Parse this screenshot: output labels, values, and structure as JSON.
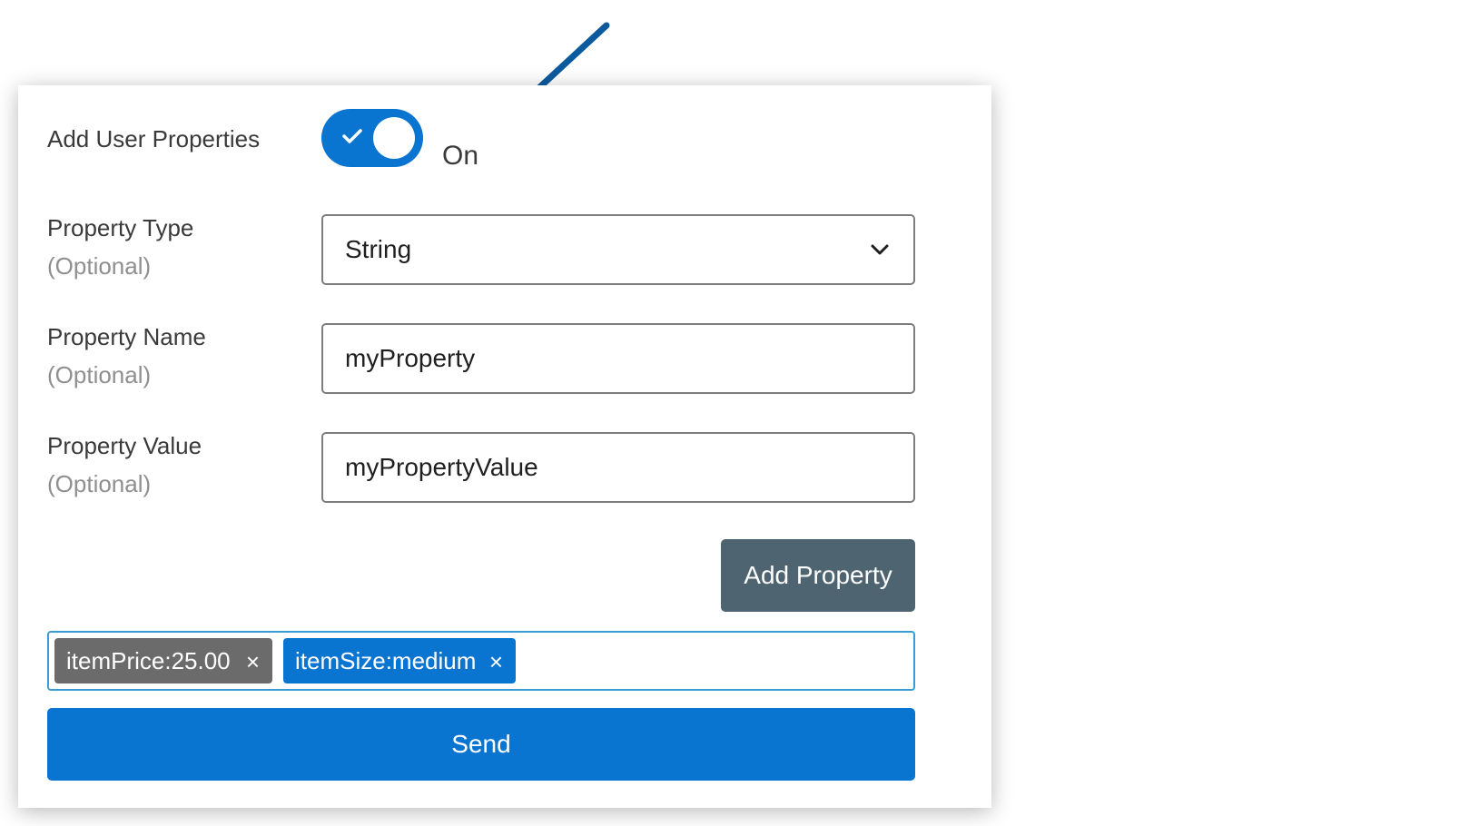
{
  "form": {
    "toggle": {
      "label": "Add User Properties",
      "state_text": "On",
      "checked": true
    },
    "property_type": {
      "label": "Property Type",
      "optional": "(Optional)",
      "value": "String"
    },
    "property_name": {
      "label": "Property Name",
      "optional": "(Optional)",
      "value": "myProperty"
    },
    "property_value": {
      "label": "Property Value",
      "optional": "(Optional)",
      "value": "myPropertyValue"
    },
    "add_button": "Add Property",
    "tags": [
      {
        "text": "itemPrice:25.00",
        "remove": "×"
      },
      {
        "text": "itemSize:medium",
        "remove": "×"
      }
    ],
    "send_button": "Send"
  },
  "icons": {
    "arrow": "pointer-arrow-icon",
    "check": "check-icon",
    "dropdown": "chevron-down-icon",
    "remove": "close-icon"
  },
  "colors": {
    "primary": "#0a74d1",
    "secondary_button": "#4f6471",
    "tag_grey": "#6b6b6b",
    "tagbox_border": "#3a9bd8",
    "arrow": "#0b5a9e"
  }
}
